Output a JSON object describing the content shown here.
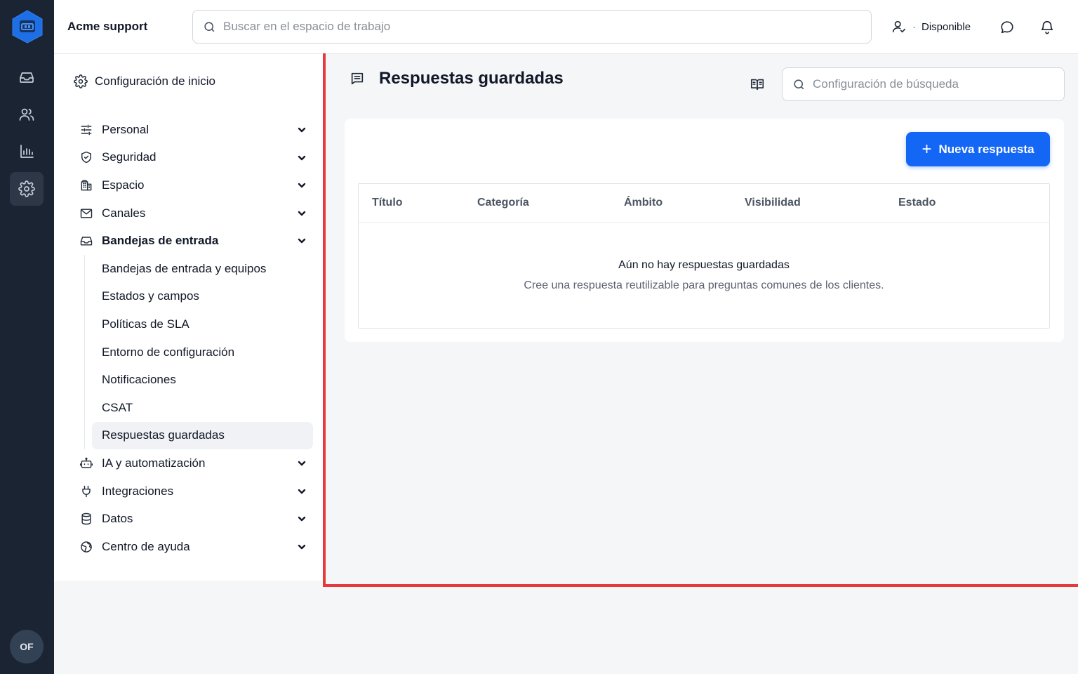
{
  "rail": {
    "nav": [
      {
        "name": "inbox"
      },
      {
        "name": "contacts"
      },
      {
        "name": "reports"
      },
      {
        "name": "settings",
        "active": true
      }
    ],
    "avatar_initials": "OF"
  },
  "topbar": {
    "org_name": "Acme support",
    "search_placeholder": "Buscar en el espacio de trabajo",
    "status_label": "Disponible",
    "status_separator": "·"
  },
  "settings_panel": {
    "title": "Configuración de inicio",
    "menu": [
      {
        "label": "Personal",
        "icon": "sliders-icon"
      },
      {
        "label": "Seguridad",
        "icon": "shield-icon"
      },
      {
        "label": "Espacio",
        "icon": "building-icon"
      },
      {
        "label": "Canales",
        "icon": "mail-icon"
      },
      {
        "label": "Bandejas de entrada",
        "icon": "inbox-icon",
        "expanded": true
      },
      {
        "label": "IA y automatización",
        "icon": "bot-icon"
      },
      {
        "label": "Integraciones",
        "icon": "plug-icon"
      },
      {
        "label": "Datos",
        "icon": "database-icon"
      },
      {
        "label": "Centro de ayuda",
        "icon": "globe-icon"
      }
    ],
    "submenu": [
      "Bandejas de entrada y equipos",
      "Estados y campos",
      "Políticas de SLA",
      "Entorno de configuración",
      "Notificaciones",
      "CSAT",
      "Respuestas guardadas"
    ],
    "active_submenu": "Respuestas guardadas"
  },
  "main": {
    "title": "Respuestas guardadas",
    "config_search_placeholder": "Configuración de búsqueda",
    "new_button_label": "Nueva respuesta",
    "new_button_icon": "+",
    "columns": [
      "Título",
      "Categoría",
      "Ámbito",
      "Visibilidad",
      "Estado"
    ],
    "empty_title": "Aún no hay respuestas guardadas",
    "empty_subtitle": "Cree una respuesta reutilizable para preguntas comunes de los clientes."
  },
  "colors": {
    "rail": "#1b2433",
    "accent": "#1466f5",
    "highlight_border": "#e5393d"
  }
}
